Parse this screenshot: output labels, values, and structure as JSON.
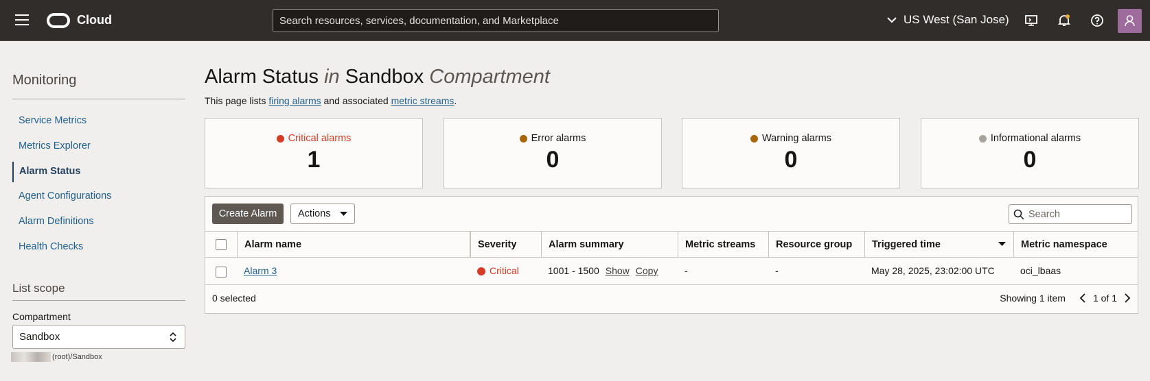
{
  "header": {
    "brand": "Cloud",
    "search_placeholder": "Search resources, services, documentation, and Marketplace",
    "region": "US West (San Jose)"
  },
  "sidebar": {
    "title": "Monitoring",
    "items": [
      {
        "label": "Service Metrics"
      },
      {
        "label": "Metrics Explorer"
      },
      {
        "label": "Alarm Status"
      },
      {
        "label": "Agent Configurations"
      },
      {
        "label": "Alarm Definitions"
      },
      {
        "label": "Health Checks"
      }
    ],
    "list_scope": {
      "title": "List scope",
      "compartment_label": "Compartment",
      "compartment_value": "Sandbox",
      "compartment_path": "(root)/Sandbox"
    }
  },
  "page": {
    "title_main": "Alarm Status",
    "title_in": "in",
    "title_compartment": "Sandbox",
    "title_suffix": "Compartment",
    "desc_prefix": "This page lists",
    "desc_link1": "firing alarms",
    "desc_middle": "and associated",
    "desc_link2": "metric streams",
    "desc_end": "."
  },
  "stats": [
    {
      "label": "Critical alarms",
      "count": "1",
      "color": "#d63b25"
    },
    {
      "label": "Error alarms",
      "count": "0",
      "color": "#a8650b"
    },
    {
      "label": "Warning alarms",
      "count": "0",
      "color": "#a8650b"
    },
    {
      "label": "Informational alarms",
      "count": "0",
      "color": "#a8a29c"
    }
  ],
  "toolbar": {
    "create_label": "Create Alarm",
    "actions_label": "Actions",
    "search_placeholder": "Search"
  },
  "table": {
    "columns": [
      "Alarm name",
      "Severity",
      "Alarm summary",
      "Metric streams",
      "Resource group",
      "Triggered time",
      "Metric namespace"
    ],
    "rows": [
      {
        "name": "Alarm 3",
        "severity": "Critical",
        "summary": "1001 - 1500",
        "show": "Show",
        "copy": "Copy",
        "metric_streams": "-",
        "resource_group": "-",
        "triggered": "May 28, 2025, 23:02:00 UTC",
        "namespace": "oci_lbaas"
      }
    ],
    "selected_text": "0 selected",
    "showing_text": "Showing 1 item",
    "page_text": "1 of 1"
  },
  "colors": {
    "critical": "#d63b25",
    "link": "#1f5f8b",
    "topbar": "#312d2a"
  }
}
